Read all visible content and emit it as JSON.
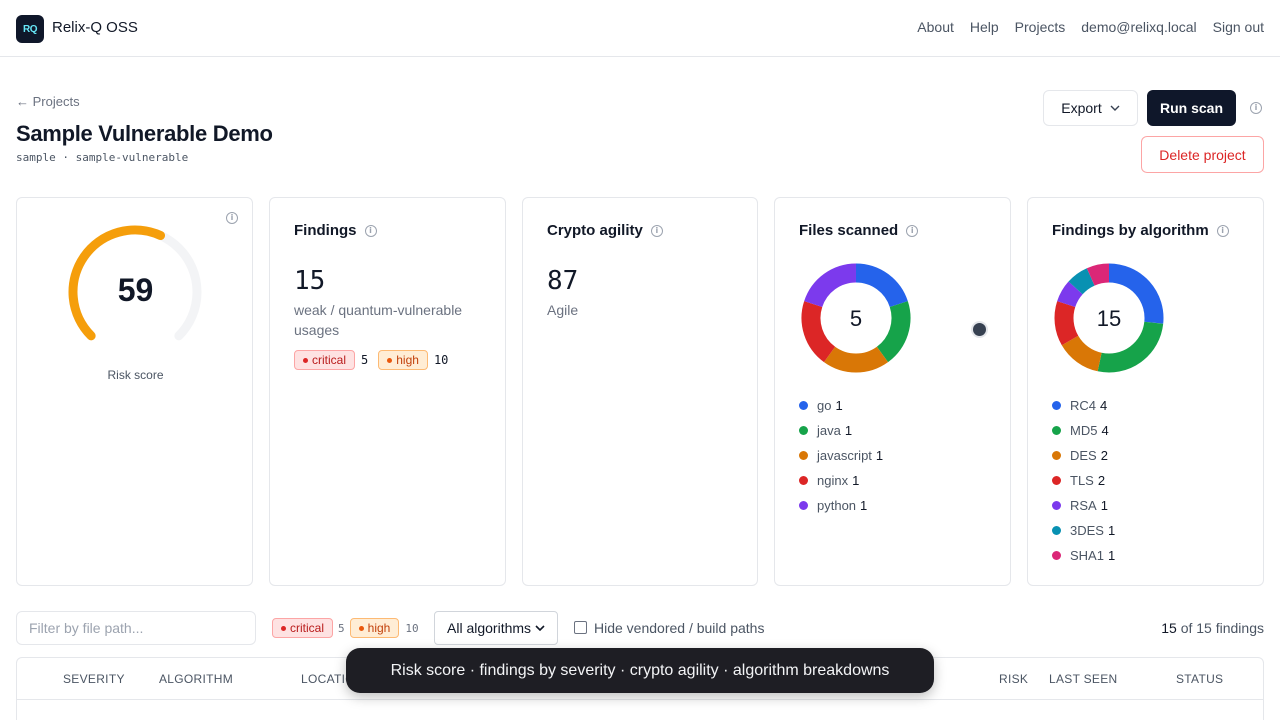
{
  "app": {
    "logo": "RQ",
    "title": "Relix-Q OSS"
  },
  "nav": [
    "About",
    "Help",
    "Projects",
    "demo@relixq.local",
    "Sign out"
  ],
  "page": {
    "back": "← Projects",
    "title": "Sample Vulnerable Demo",
    "subtitle": "sample · sample-vulnerable"
  },
  "actions": {
    "export": "Export",
    "run_scan": "Run scan",
    "delete": "Delete project"
  },
  "risk": {
    "score": "59",
    "label": "Risk score",
    "value": 59,
    "max": 100,
    "color": "#f59e0b"
  },
  "findings": {
    "title": "Findings",
    "count": "15",
    "subtitle": "weak / quantum-vulnerable usages",
    "critical_label": "critical",
    "critical_count": "5",
    "high_label": "high",
    "high_count": "10"
  },
  "agility": {
    "title": "Crypto agility",
    "score": "87",
    "label": "Agile"
  },
  "files": {
    "title": "Files scanned",
    "total": "5",
    "items": [
      {
        "name": "go",
        "count": "1",
        "color": "#2563eb"
      },
      {
        "name": "java",
        "count": "1",
        "color": "#16a34a"
      },
      {
        "name": "javascript",
        "count": "1",
        "color": "#d97706"
      },
      {
        "name": "nginx",
        "count": "1",
        "color": "#dc2626"
      },
      {
        "name": "python",
        "count": "1",
        "color": "#7c3aed"
      }
    ]
  },
  "algorithms": {
    "title": "Findings by algorithm",
    "total": "15",
    "items": [
      {
        "name": "RC4",
        "count": "4",
        "color": "#2563eb"
      },
      {
        "name": "MD5",
        "count": "4",
        "color": "#16a34a"
      },
      {
        "name": "DES",
        "count": "2",
        "color": "#d97706"
      },
      {
        "name": "TLS",
        "count": "2",
        "color": "#dc2626"
      },
      {
        "name": "RSA",
        "count": "1",
        "color": "#7c3aed"
      },
      {
        "name": "3DES",
        "count": "1",
        "color": "#0891b2"
      },
      {
        "name": "SHA1",
        "count": "1",
        "color": "#db2777"
      }
    ]
  },
  "filters": {
    "path_placeholder": "Filter by file path...",
    "critical_label": "critical",
    "critical_count": "5",
    "high_label": "high",
    "high_count": "10",
    "algorithm_select": "All algorithms",
    "hide_vendored": "Hide vendored / build paths",
    "shown": "15",
    "total_text": "of 15 findings"
  },
  "table": {
    "headers": {
      "severity": "SEVERITY",
      "algorithm": "ALGORITHM",
      "location": "LOCATION",
      "risk": "RISK",
      "last_seen": "LAST SEEN",
      "status": "STATUS"
    }
  },
  "tooltip": "Risk score · findings by severity · crypto agility · algorithm breakdowns"
}
